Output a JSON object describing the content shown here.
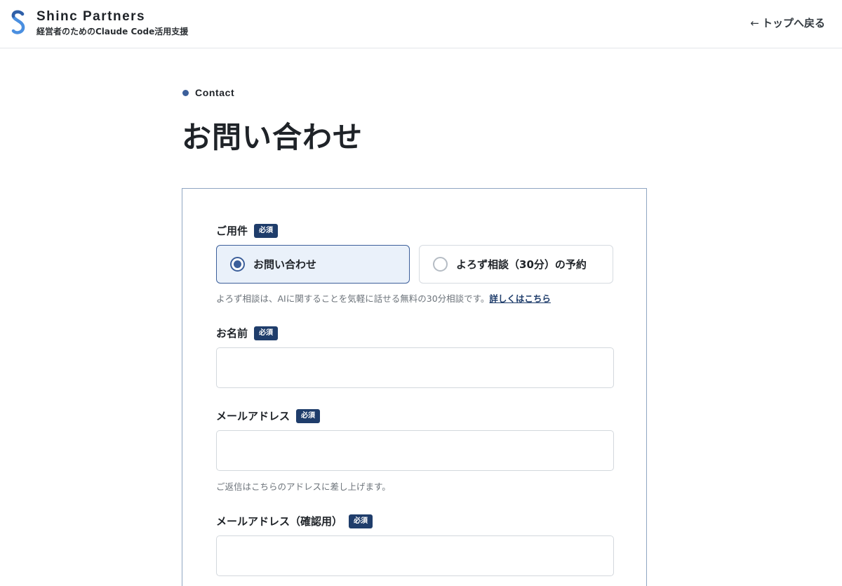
{
  "header": {
    "brand_name": "Shinc Partners",
    "tagline": "経営者のためのClaude Code活用支援",
    "back_link_arrow": "←",
    "back_link_label": "トップへ戻る",
    "logo_icon": "s-logo-icon"
  },
  "section": {
    "eyebrow": "Contact",
    "title": "お問い合わせ"
  },
  "colors": {
    "accent": "#3c5f9a",
    "badge_bg": "#1f3d6b",
    "card_border": "#8fa6c2",
    "selected_bg": "#eaf1fa"
  },
  "form": {
    "required_badge": "必須",
    "inquiry_type": {
      "label": "ご用件",
      "options": [
        {
          "label": "お問い合わせ",
          "selected": true
        },
        {
          "label": "よろず相談（30分）の予約",
          "selected": false
        }
      ],
      "note": "よろず相談は、AIに関することを気軽に話せる無料の30分相談です。",
      "note_link": "詳しくはこちら"
    },
    "name": {
      "label": "お名前",
      "value": "",
      "placeholder": ""
    },
    "email": {
      "label": "メールアドレス",
      "value": "",
      "placeholder": "",
      "note": "ご返信はこちらのアドレスに差し上げます。"
    },
    "email_confirm": {
      "label": "メールアドレス（確認用）",
      "value": "",
      "placeholder": ""
    }
  }
}
